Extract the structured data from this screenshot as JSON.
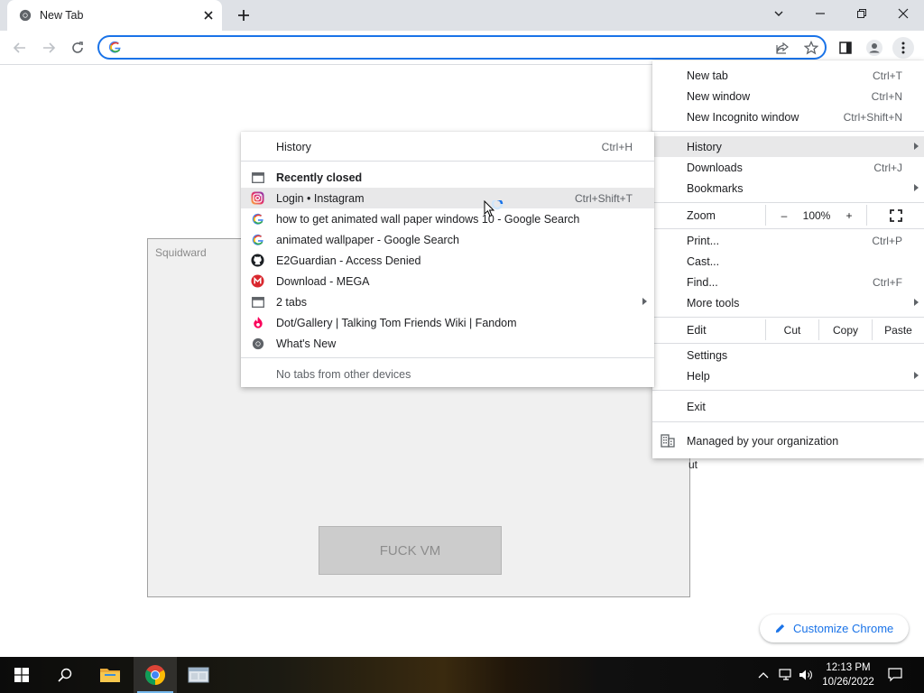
{
  "browser": {
    "tab_title": "New Tab",
    "omnibox_value": "",
    "accent_color": "#1a73e8"
  },
  "page": {
    "dialog_title": "Squidward",
    "dialog_button": "FUCK VM",
    "partial_text": "ut",
    "customize_label": "Customize Chrome"
  },
  "main_menu": {
    "new_tab": {
      "label": "New tab",
      "shortcut": "Ctrl+T"
    },
    "new_window": {
      "label": "New window",
      "shortcut": "Ctrl+N"
    },
    "new_incognito": {
      "label": "New Incognito window",
      "shortcut": "Ctrl+Shift+N"
    },
    "history": {
      "label": "History"
    },
    "downloads": {
      "label": "Downloads",
      "shortcut": "Ctrl+J"
    },
    "bookmarks": {
      "label": "Bookmarks"
    },
    "zoom": {
      "label": "Zoom",
      "minus": "–",
      "value": "100%",
      "plus": "+"
    },
    "print": {
      "label": "Print...",
      "shortcut": "Ctrl+P"
    },
    "cast": {
      "label": "Cast..."
    },
    "find": {
      "label": "Find...",
      "shortcut": "Ctrl+F"
    },
    "more_tools": {
      "label": "More tools"
    },
    "edit": {
      "label": "Edit",
      "cut": "Cut",
      "copy": "Copy",
      "paste": "Paste"
    },
    "settings": {
      "label": "Settings"
    },
    "help": {
      "label": "Help"
    },
    "exit": {
      "label": "Exit"
    },
    "managed": {
      "label": "Managed by your organization"
    }
  },
  "history_menu": {
    "history": {
      "label": "History",
      "shortcut": "Ctrl+H"
    },
    "recently_closed": "Recently closed",
    "items": [
      {
        "label": "Login • Instagram",
        "shortcut": "Ctrl+Shift+T",
        "icon": "instagram-icon"
      },
      {
        "label": "how to get animated wall paper windows 10 - Google Search",
        "icon": "google-icon"
      },
      {
        "label": "animated wallpaper - Google Search",
        "icon": "google-icon"
      },
      {
        "label": "E2Guardian - Access Denied",
        "icon": "github-icon"
      },
      {
        "label": "Download - MEGA",
        "icon": "mega-icon"
      },
      {
        "label": "2 tabs",
        "icon": "window-icon"
      },
      {
        "label": "Dot/Gallery | Talking Tom  Friends Wiki | Fandom",
        "icon": "fandom-icon"
      },
      {
        "label": "What's New",
        "icon": "chrome-icon"
      }
    ],
    "no_tabs": "No tabs from other devices"
  },
  "taskbar": {
    "time": "12:13 PM",
    "date": "10/26/2022"
  }
}
